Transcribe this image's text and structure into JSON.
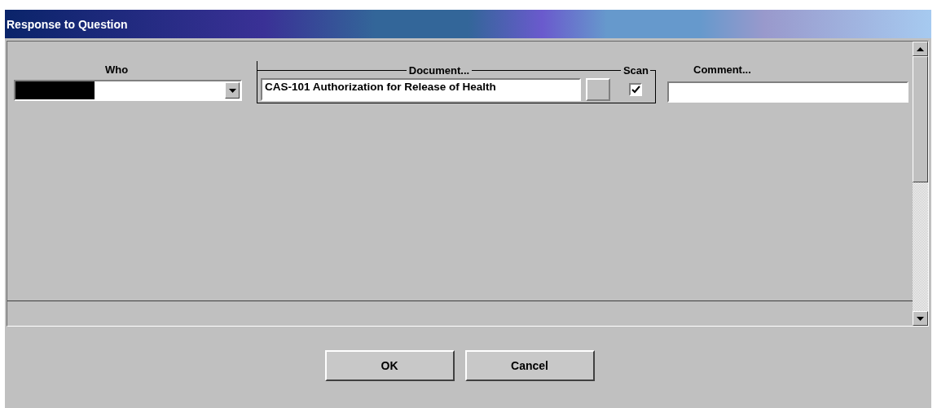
{
  "window": {
    "title": "Response to Question"
  },
  "columns": {
    "who": "Who",
    "document": "Document...",
    "scan": "Scan",
    "comment": "Comment..."
  },
  "row": {
    "who": {
      "redacted": true
    },
    "document": "CAS-101 Authorization for Release of Health",
    "scan": {
      "checked": true
    }
  },
  "buttons": [
    "OK",
    "Cancel"
  ]
}
